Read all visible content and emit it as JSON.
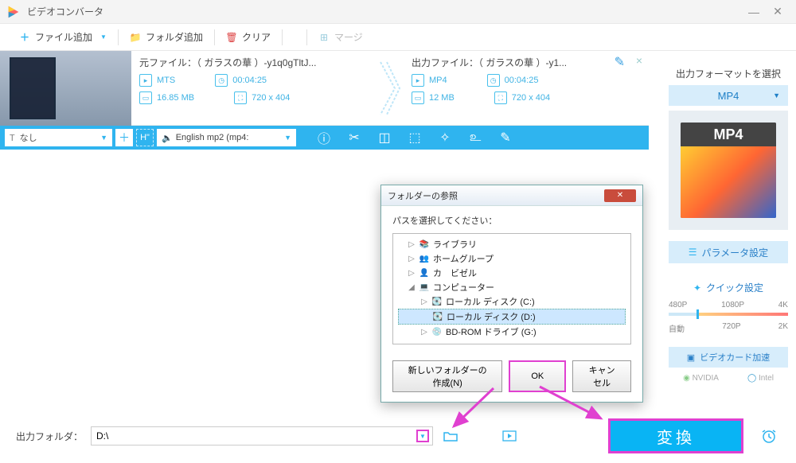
{
  "window": {
    "title": "ビデオコンバータ"
  },
  "toolbar": {
    "add_file": "ファイル追加",
    "add_folder": "フォルダ追加",
    "clear": "クリア",
    "merge": "マージ"
  },
  "source": {
    "title_prefix": "元ファイル：",
    "filename": "（ ガラスの華 ）-y1q0gTltJ...",
    "format": "MTS",
    "duration": "00:04:25",
    "size": "16.85 MB",
    "resolution": "720 x 404"
  },
  "output": {
    "title_prefix": "出力ファイル：",
    "filename": "（ ガラスの華 ）-y1...",
    "format": "MP4",
    "duration": "00:04:25",
    "size": "12 MB",
    "resolution": "720 x 404"
  },
  "strip": {
    "subtitle_none": "なし",
    "audio_track": "English mp2 (mp4:"
  },
  "right": {
    "title": "出力フォーマットを選択",
    "format": "MP4",
    "card_label": "MP4",
    "param_btn": "パラメータ設定",
    "quick_title": "クイック設定",
    "presets_row1": [
      "480P",
      "1080P",
      "4K"
    ],
    "presets_row2": [
      "自動",
      "720P",
      "2K"
    ],
    "gpu_btn": "ビデオカード加速",
    "gpu_nvidia": "NVIDIA",
    "gpu_intel": "Intel"
  },
  "bottom": {
    "label": "出力フォルダ：",
    "path": "D:\\",
    "convert": "変換"
  },
  "dialog": {
    "title": "フォルダーの参照",
    "message": "パスを選択してください：",
    "tree": [
      {
        "indent": 1,
        "exp": "▷",
        "icon": "lib",
        "label": "ライブラリ"
      },
      {
        "indent": 1,
        "exp": "▷",
        "icon": "grp",
        "label": "ホームグループ"
      },
      {
        "indent": 1,
        "exp": "▷",
        "icon": "usr",
        "label": "カ　ビゼル"
      },
      {
        "indent": 1,
        "exp": "◢",
        "icon": "pc",
        "label": "コンピューター"
      },
      {
        "indent": 2,
        "exp": "▷",
        "icon": "hd",
        "label": "ローカル ディスク (C:)"
      },
      {
        "indent": 2,
        "exp": "",
        "icon": "hd",
        "label": "ローカル ディスク (D:)",
        "selected": true
      },
      {
        "indent": 2,
        "exp": "▷",
        "icon": "cd",
        "label": "BD-ROM ドライブ (G:)"
      }
    ],
    "new_folder": "新しいフォルダーの作成(N)",
    "ok": "OK",
    "cancel": "キャンセル"
  }
}
